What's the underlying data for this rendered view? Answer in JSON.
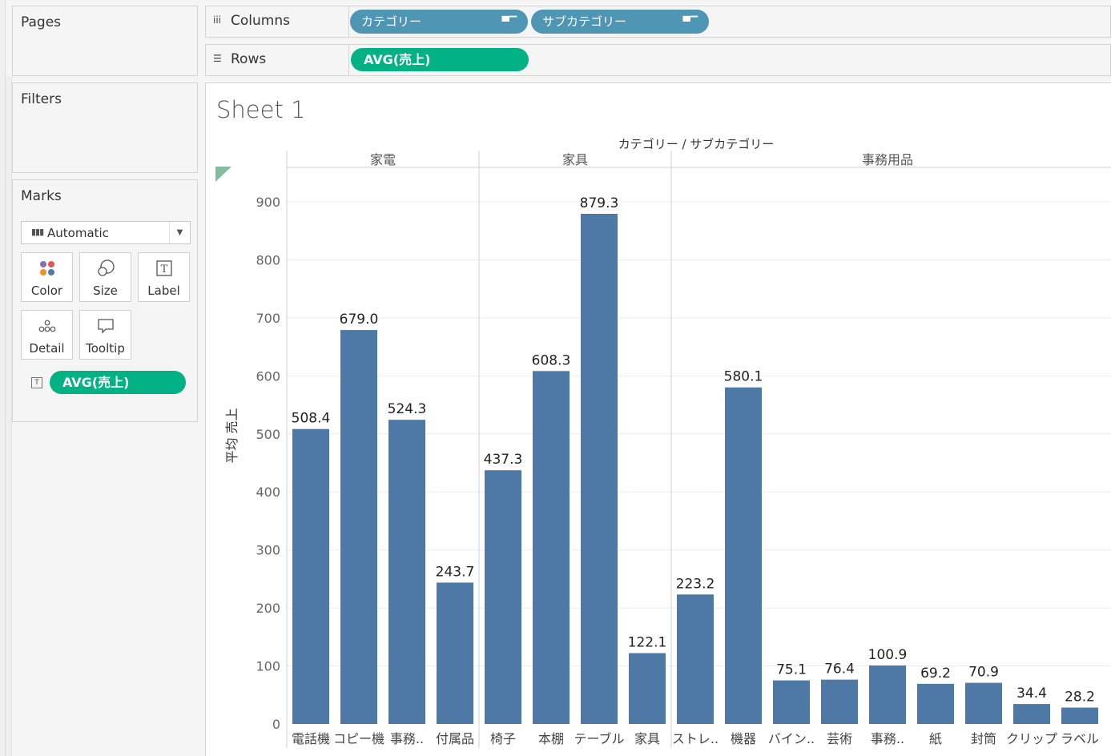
{
  "pages": {
    "title": "Pages"
  },
  "filters": {
    "title": "Filters"
  },
  "marks": {
    "title": "Marks",
    "mark_type": "Automatic",
    "buttons": [
      {
        "label": "Color",
        "icon": "color-icon"
      },
      {
        "label": "Size",
        "icon": "size-icon"
      },
      {
        "label": "Label",
        "icon": "label-icon"
      },
      {
        "label": "Detail",
        "icon": "detail-icon"
      },
      {
        "label": "Tooltip",
        "icon": "tooltip-icon"
      }
    ],
    "pill": "AVG(売上)"
  },
  "columns": {
    "label": "Columns",
    "pills": [
      "カテゴリー",
      "サブカテゴリー"
    ]
  },
  "rows": {
    "label": "Rows",
    "pills": [
      "AVG(売上)"
    ]
  },
  "sheet": {
    "title": "Sheet 1"
  },
  "colors": {
    "bar": "#4e79a7",
    "pill_green": "#02b284",
    "pill_blue": "#4f96b4"
  },
  "chart_data": {
    "type": "bar",
    "header_title": "カテゴリー / サブカテゴリー",
    "ylabel": "平均 売上",
    "ylim": [
      0,
      900
    ],
    "yticks": [
      0,
      100,
      200,
      300,
      400,
      500,
      600,
      700,
      800,
      900
    ],
    "grid": true,
    "groups": [
      {
        "name": "家電",
        "categories": [
          "電話機",
          "コピー機",
          "事務..",
          "付属品"
        ],
        "values": [
          508.4,
          679.0,
          524.3,
          243.7
        ]
      },
      {
        "name": "家具",
        "categories": [
          "椅子",
          "本棚",
          "テーブル",
          "家具"
        ],
        "values": [
          437.3,
          608.3,
          879.3,
          122.1
        ]
      },
      {
        "name": "事務用品",
        "categories": [
          "ストレ..",
          "機器",
          "バイン..",
          "芸術",
          "事務..",
          "紙",
          "封筒",
          "クリップ",
          "ラベル"
        ],
        "values": [
          223.2,
          580.1,
          75.1,
          76.4,
          100.9,
          69.2,
          70.9,
          34.4,
          28.2
        ]
      }
    ]
  }
}
